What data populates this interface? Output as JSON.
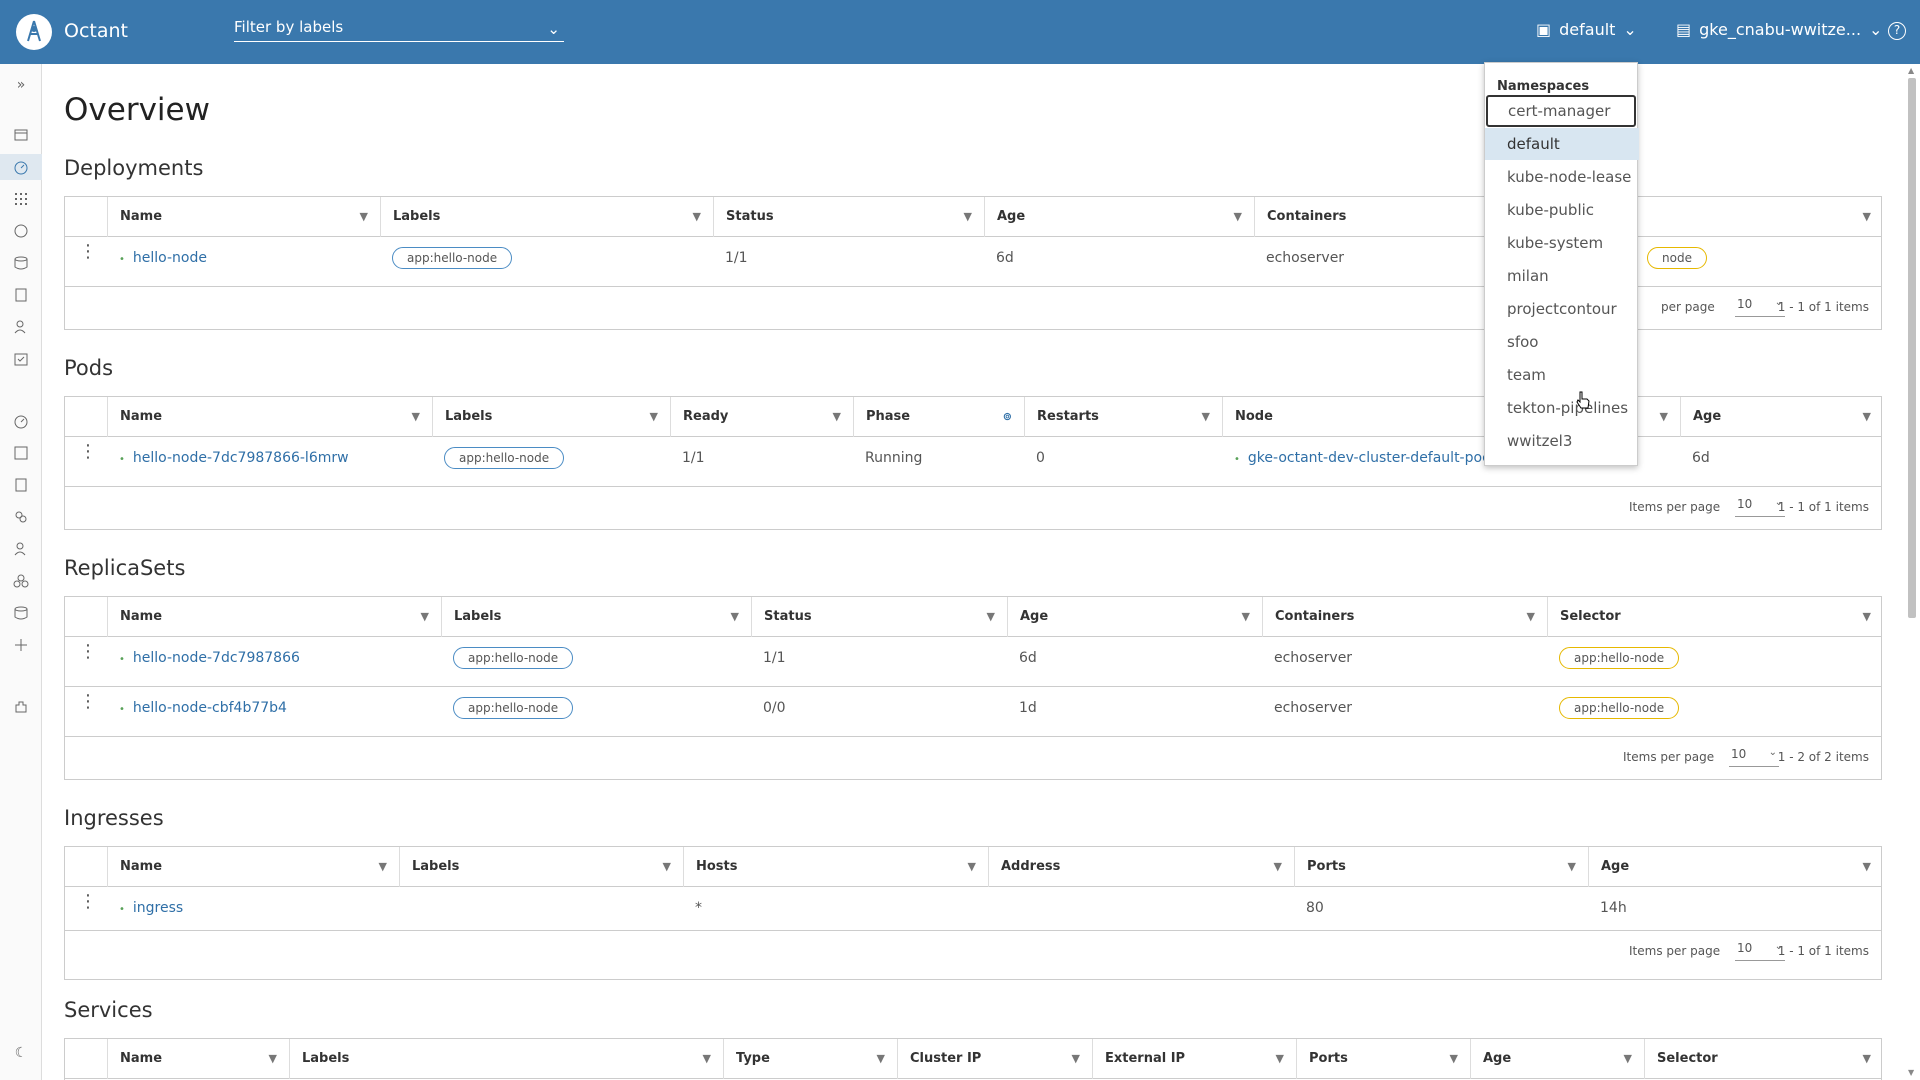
{
  "header": {
    "app_title": "Octant",
    "filter_placeholder": "Filter by labels",
    "namespace": "default",
    "context": "gke_cnabu-wwitze..."
  },
  "page_title": "Overview",
  "deployments": {
    "title": "Deployments",
    "columns": [
      "Name",
      "Labels",
      "Status",
      "Age",
      "Containers",
      ""
    ],
    "rows": [
      {
        "name": "hello-node",
        "label": "app:hello-node",
        "status": "1/1",
        "age": "6d",
        "containers": "echoserver",
        "selector": "node"
      }
    ],
    "items_per_page_label": "per page",
    "items_per_page": "10",
    "count": "1 - 1 of 1 items"
  },
  "pods": {
    "title": "Pods",
    "columns": [
      "Name",
      "Labels",
      "Ready",
      "Phase",
      "Restarts",
      "Node",
      "Age"
    ],
    "rows": [
      {
        "name": "hello-node-7dc7987866-l6mrw",
        "label": "app:hello-node",
        "ready": "1/1",
        "phase": "Running",
        "restarts": "0",
        "node": "gke-octant-dev-cluster-default-poc",
        "age": "6d"
      }
    ],
    "items_per_page_label": "Items per page",
    "items_per_page": "10",
    "count": "1 - 1 of 1 items"
  },
  "replicasets": {
    "title": "ReplicaSets",
    "columns": [
      "Name",
      "Labels",
      "Status",
      "Age",
      "Containers",
      "Selector"
    ],
    "rows": [
      {
        "name": "hello-node-7dc7987866",
        "label": "app:hello-node",
        "status": "1/1",
        "age": "6d",
        "containers": "echoserver",
        "selector": "app:hello-node"
      },
      {
        "name": "hello-node-cbf4b77b4",
        "label": "app:hello-node",
        "status": "0/0",
        "age": "1d",
        "containers": "echoserver",
        "selector": "app:hello-node"
      }
    ],
    "items_per_page_label": "Items per page",
    "items_per_page": "10",
    "count": "1 - 2 of 2 items"
  },
  "ingresses": {
    "title": "Ingresses",
    "columns": [
      "Name",
      "Labels",
      "Hosts",
      "Address",
      "Ports",
      "Age"
    ],
    "rows": [
      {
        "name": "ingress",
        "label": "",
        "hosts": "*",
        "address": "",
        "ports": "80",
        "age": "14h"
      }
    ],
    "items_per_page_label": "Items per page",
    "items_per_page": "10",
    "count": "1 - 1 of 1 items"
  },
  "services": {
    "title": "Services",
    "columns": [
      "Name",
      "Labels",
      "Type",
      "Cluster IP",
      "External IP",
      "Ports",
      "Age",
      "Selector"
    ]
  },
  "namespace_dropdown": {
    "heading": "Namespaces",
    "items": [
      "cert-manager",
      "default",
      "kube-node-lease",
      "kube-public",
      "kube-system",
      "milan",
      "projectcontour",
      "sfoo",
      "team",
      "tekton-pipelines",
      "wwitzel3"
    ],
    "focused": "cert-manager",
    "selected": "default"
  },
  "colors": {
    "header_bg": "#3a78ad",
    "link": "#2f6fa7",
    "chip_border": "#4b8cc4",
    "selector_chip": "#e6b800"
  }
}
